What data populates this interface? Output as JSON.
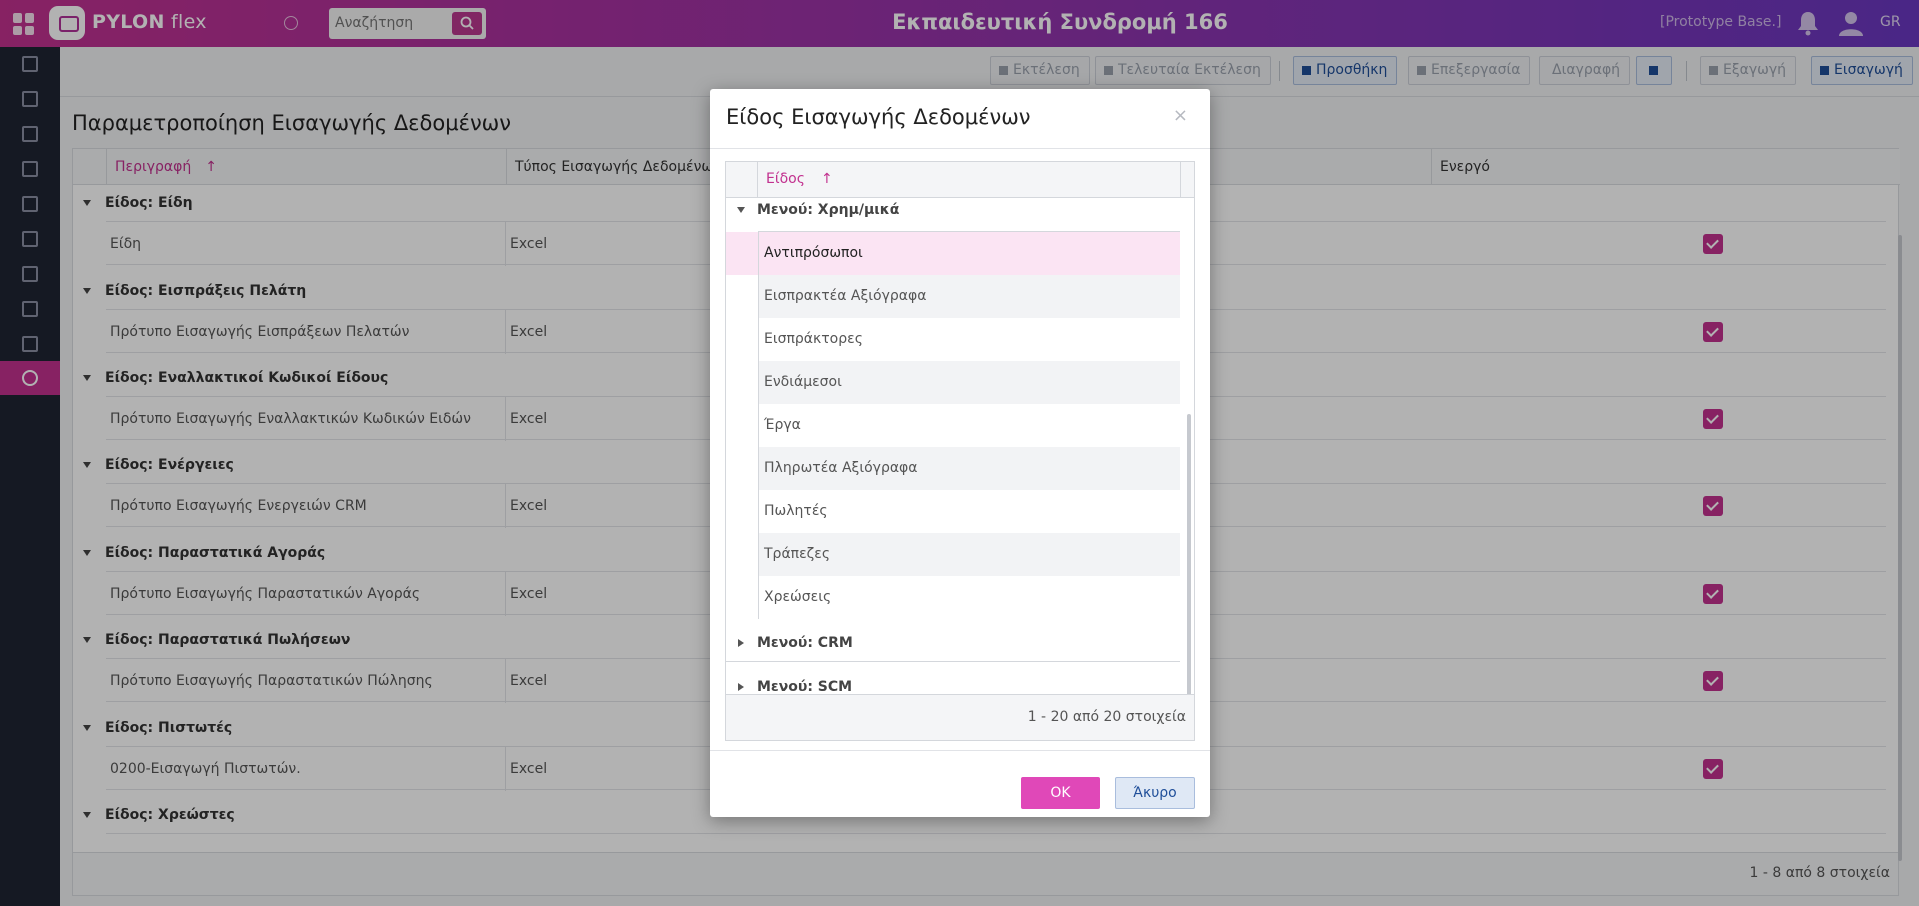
{
  "topbar": {
    "brand_bold": "PYLON",
    "brand_light": " flex",
    "search_placeholder": "Αναζήτηση",
    "title": "Εκπαιδευτική Συνδρομή 166",
    "database": "[Prototype Base.]",
    "language": "GR"
  },
  "toolbar": {
    "execute": "Εκτέλεση",
    "last_execution": "Τελευταία Εκτέλεση",
    "add": "Προσθήκη",
    "edit": "Επεξεργασία",
    "delete": "Διαγραφή",
    "export": "Εξαγωγή",
    "import": "Εισαγωγή"
  },
  "page": {
    "title": "Παραμετροποίηση Εισαγωγής Δεδομένων",
    "columns": {
      "description": "Περιγραφή",
      "sort_arrow": "↑",
      "import_type": "Τύπος Εισαγωγής Δεδομένων",
      "active": "Ενεργό"
    },
    "groups": [
      {
        "label": "Είδος: Είδη",
        "row": {
          "description": "Είδη",
          "type": "Excel",
          "active": true
        }
      },
      {
        "label": "Είδος: Εισπράξεις Πελάτη",
        "row": {
          "description": "Πρότυπο Εισαγωγής Εισπράξεων Πελατών",
          "type": "Excel",
          "active": true
        }
      },
      {
        "label": "Είδος: Εναλλακτικοί Κωδικοί Είδους",
        "row": {
          "description": "Πρότυπο Εισαγωγής Εναλλακτικών Κωδικών Ειδών",
          "type": "Excel",
          "active": true
        }
      },
      {
        "label": "Είδος: Ενέργειες",
        "row": {
          "description": "Πρότυπο Εισαγωγής Ενεργειών CRM",
          "type": "Excel",
          "active": true
        }
      },
      {
        "label": "Είδος: Παραστατικά Αγοράς",
        "row": {
          "description": "Πρότυπο Εισαγωγής Παραστατικών Αγοράς",
          "type": "Excel",
          "active": true
        }
      },
      {
        "label": "Είδος: Παραστατικά Πωλήσεων",
        "row": {
          "description": "Πρότυπο Εισαγωγής Παραστατικών Πώλησης",
          "type": "Excel",
          "active": true
        }
      },
      {
        "label": "Είδος: Πιστωτές",
        "row": {
          "description": "0200-Εισαγωγή Πιστωτών.",
          "type": "Excel",
          "active": true
        }
      },
      {
        "label": "Είδος: Χρεώστες"
      }
    ],
    "pager": "1 - 8 από 8 στοιχεία"
  },
  "dialog": {
    "title": "Είδος Εισαγωγής Δεδομένων",
    "close": "×",
    "column": "Είδος",
    "sort_arrow": "↑",
    "group_open": "Μενού: Χρημ/μικά",
    "items": [
      "Αντιπρόσωποι",
      "Εισπρακτέα Αξιόγραφα",
      "Εισπράκτορες",
      "Ενδιάμεσοι",
      "Έργα",
      "Πληρωτέα Αξιόγραφα",
      "Πωλητές",
      "Τράπεζες",
      "Χρεώσεις"
    ],
    "selected_index": 0,
    "groups_closed": [
      "Μενού: CRM",
      "Μενού: SCM"
    ],
    "pager": "1 - 20 από 20 στοιχεία",
    "ok": "OK",
    "cancel": "Άκυρο"
  },
  "colors": {
    "accent": "#c2318f",
    "ok_button": "#e048b8",
    "selected_row": "#fbe4f3",
    "sidebar": "#1f2433"
  }
}
